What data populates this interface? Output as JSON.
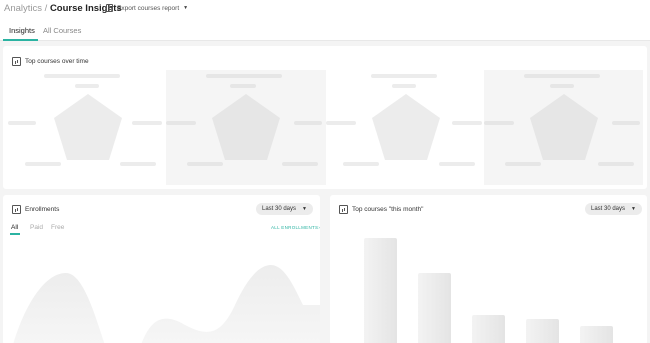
{
  "header": {
    "breadcrumb_parent": "Analytics",
    "breadcrumb_separator": "/",
    "breadcrumb_current": "Course Insights",
    "export_label": "Export courses report"
  },
  "tabs": [
    {
      "label": "Insights",
      "active": true
    },
    {
      "label": "All Courses",
      "active": false
    }
  ],
  "top_courses_card": {
    "title": "Top courses over time",
    "panel_count": 4
  },
  "enrollments_card": {
    "title": "Enrollments",
    "range": "Last 30 days",
    "subtabs": [
      {
        "label": "All",
        "active": true
      },
      {
        "label": "Paid",
        "active": false
      },
      {
        "label": "Free",
        "active": false
      }
    ],
    "all_enrollments_link": "ALL ENROLLMENTS"
  },
  "top_month_card": {
    "title": "Top courses \"this month\"",
    "range": "Last 30 days"
  },
  "colors": {
    "accent": "#2bb3a2",
    "background": "#f4f4f4",
    "card": "#ffffff",
    "skeleton": "#ececec"
  }
}
